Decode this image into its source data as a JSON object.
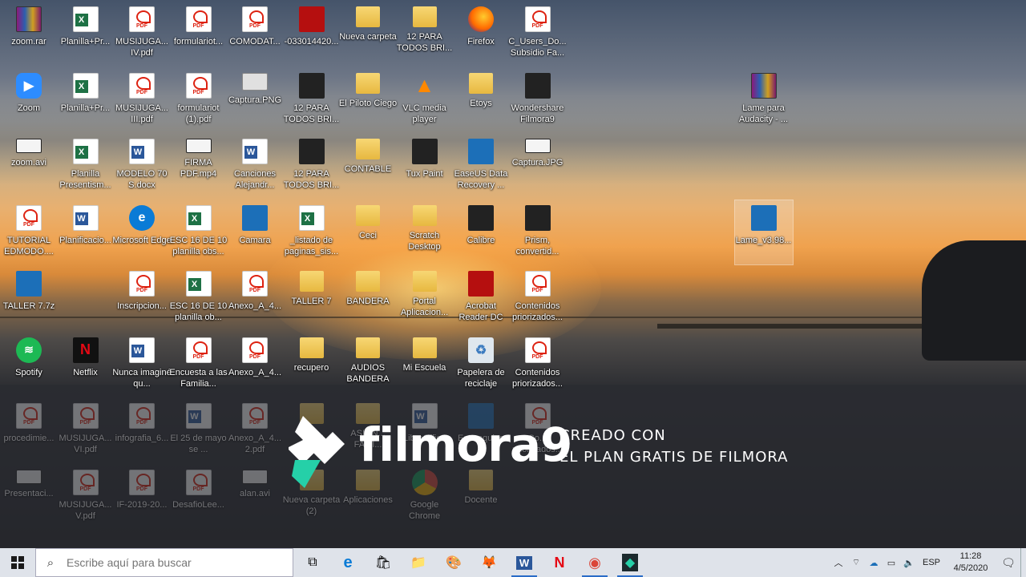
{
  "desktop": {
    "icons": [
      {
        "label": "zoom.rar",
        "type": "rar",
        "col": 0,
        "row": 0
      },
      {
        "label": "Planilla+Pr...",
        "type": "xls",
        "col": 1,
        "row": 0
      },
      {
        "label": "MUSIJUGA... IV.pdf",
        "type": "pdf",
        "col": 2,
        "row": 0
      },
      {
        "label": "formulariot...",
        "type": "pdf",
        "col": 3,
        "row": 0
      },
      {
        "label": "COMODAT...",
        "type": "pdf",
        "col": 4,
        "row": 0
      },
      {
        "label": "-033014420...",
        "type": "red",
        "col": 5,
        "row": 0
      },
      {
        "label": "Nueva carpeta",
        "type": "folder",
        "col": 6,
        "row": 0
      },
      {
        "label": "12 PARA TODOS BRI...",
        "type": "folder",
        "col": 7,
        "row": 0
      },
      {
        "label": "Firefox",
        "type": "firefox",
        "col": 8,
        "row": 0
      },
      {
        "label": "C_Users_Do... Subsidio Fa...",
        "type": "pdf",
        "col": 9,
        "row": 0
      },
      {
        "label": "Zoom",
        "type": "zoom",
        "col": 0,
        "row": 1
      },
      {
        "label": "Planilla+Pr...",
        "type": "xls",
        "col": 1,
        "row": 1
      },
      {
        "label": "MUSIJUGA... III.pdf",
        "type": "pdf",
        "col": 2,
        "row": 1
      },
      {
        "label": "formulariot (1).pdf",
        "type": "pdf",
        "col": 3,
        "row": 1
      },
      {
        "label": "Captura.PNG",
        "type": "img",
        "col": 4,
        "row": 1
      },
      {
        "label": "12 PARA TODOS BRI...",
        "type": "black",
        "col": 5,
        "row": 1
      },
      {
        "label": "El Piloto Ciego",
        "type": "folder",
        "col": 6,
        "row": 1
      },
      {
        "label": "VLC media player",
        "type": "vlc",
        "col": 7,
        "row": 1
      },
      {
        "label": "Etoys",
        "type": "folder",
        "col": 8,
        "row": 1
      },
      {
        "label": "Wondershare Filmora9",
        "type": "black",
        "col": 9,
        "row": 1
      },
      {
        "label": "Lame para Audacity - ...",
        "type": "rar",
        "col": 13,
        "row": 1
      },
      {
        "label": "zoom.avi",
        "type": "video",
        "col": 0,
        "row": 2
      },
      {
        "label": "Planilla Presentism...",
        "type": "xls",
        "col": 1,
        "row": 2
      },
      {
        "label": "MODELO 70 S.docx",
        "type": "doc",
        "col": 2,
        "row": 2
      },
      {
        "label": "FIRMA PDF.mp4",
        "type": "video",
        "col": 3,
        "row": 2
      },
      {
        "label": "Canciones Alejandr...",
        "type": "doc",
        "col": 4,
        "row": 2
      },
      {
        "label": "12 PARA TODOS BRI...",
        "type": "black",
        "col": 5,
        "row": 2
      },
      {
        "label": "CONTABLE",
        "type": "folder",
        "col": 6,
        "row": 2
      },
      {
        "label": "Tux Paint",
        "type": "black",
        "col": 7,
        "row": 2
      },
      {
        "label": "EaseUS Data Recovery ...",
        "type": "blue",
        "col": 8,
        "row": 2
      },
      {
        "label": "Captura.JPG",
        "type": "video",
        "col": 9,
        "row": 2
      },
      {
        "label": "TUTORIAL EDMODO....",
        "type": "pdf",
        "col": 0,
        "row": 3
      },
      {
        "label": "Planificacio...",
        "type": "doc",
        "col": 1,
        "row": 3
      },
      {
        "label": "Microsoft Edge",
        "type": "edge",
        "col": 2,
        "row": 3
      },
      {
        "label": "ESC 16 DE 10 planilla obs...",
        "type": "xls",
        "col": 3,
        "row": 3
      },
      {
        "label": "Camara",
        "type": "blue",
        "col": 4,
        "row": 3
      },
      {
        "label": "_listado de paginas_sis...",
        "type": "xls",
        "col": 5,
        "row": 3
      },
      {
        "label": "Ceci",
        "type": "folder",
        "col": 6,
        "row": 3
      },
      {
        "label": "Scratch Desktop",
        "type": "folder",
        "col": 7,
        "row": 3
      },
      {
        "label": "Calibre",
        "type": "black",
        "col": 8,
        "row": 3
      },
      {
        "label": "Prism, convertid...",
        "type": "black",
        "col": 9,
        "row": 3
      },
      {
        "label": "Lame_v3.98...",
        "type": "blue",
        "col": 13,
        "row": 3,
        "selected": true
      },
      {
        "label": "TALLER 7.7z",
        "type": "blue",
        "col": 0,
        "row": 4
      },
      {
        "label": "Inscripcion...",
        "type": "pdf",
        "col": 2,
        "row": 4
      },
      {
        "label": "ESC 16 DE 10 planilla ob...",
        "type": "xls",
        "col": 3,
        "row": 4
      },
      {
        "label": "Anexo_A_4...",
        "type": "pdf",
        "col": 4,
        "row": 4
      },
      {
        "label": "TALLER 7",
        "type": "folder",
        "col": 5,
        "row": 4
      },
      {
        "label": "BANDERA",
        "type": "folder",
        "col": 6,
        "row": 4
      },
      {
        "label": "Portal Aplicacion...",
        "type": "folder",
        "col": 7,
        "row": 4
      },
      {
        "label": "Acrobat Reader DC",
        "type": "red",
        "col": 8,
        "row": 4
      },
      {
        "label": "Contenidos priorizados...",
        "type": "pdf",
        "col": 9,
        "row": 4
      },
      {
        "label": "Spotify",
        "type": "green",
        "col": 0,
        "row": 5
      },
      {
        "label": "Netflix",
        "type": "netflix",
        "col": 1,
        "row": 5
      },
      {
        "label": "Nunca imaginé qu...",
        "type": "doc",
        "col": 2,
        "row": 5
      },
      {
        "label": "Encuesta a las Familia...",
        "type": "pdf",
        "col": 3,
        "row": 5
      },
      {
        "label": "Anexo_A_4...",
        "type": "pdf",
        "col": 4,
        "row": 5
      },
      {
        "label": "recupero",
        "type": "folder",
        "col": 5,
        "row": 5
      },
      {
        "label": "AUDIOS BANDERA",
        "type": "folder",
        "col": 6,
        "row": 5
      },
      {
        "label": "Mi Escuela",
        "type": "folder",
        "col": 7,
        "row": 5
      },
      {
        "label": "Papelera de reciclaje",
        "type": "recycle",
        "col": 8,
        "row": 5
      },
      {
        "label": "Contenidos priorizados...",
        "type": "pdf",
        "col": 9,
        "row": 5
      },
      {
        "label": "procedimie...",
        "type": "pdf",
        "col": 0,
        "row": 6,
        "faded": true
      },
      {
        "label": "MUSIJUGA... VI.pdf",
        "type": "pdf",
        "col": 1,
        "row": 6,
        "faded": true
      },
      {
        "label": "infografia_6...",
        "type": "pdf",
        "col": 2,
        "row": 6,
        "faded": true
      },
      {
        "label": "El 25 de mayo se ...",
        "type": "doc",
        "col": 3,
        "row": 6,
        "faded": true
      },
      {
        "label": "Anexo_A_4... 2.pdf",
        "type": "pdf",
        "col": 4,
        "row": 6,
        "faded": true
      },
      {
        "label": "carp...",
        "type": "folder",
        "col": 5,
        "row": 6,
        "faded": true
      },
      {
        "label": "ASIGN... FAMI...",
        "type": "folder",
        "col": 6,
        "row": 6,
        "faded": true
      },
      {
        "label": "LibreOffice",
        "type": "doc",
        "col": 7,
        "row": 6,
        "faded": true
      },
      {
        "label": "Este equipo",
        "type": "blue",
        "col": 8,
        "row": 6,
        "faded": true
      },
      {
        "label": "Co... priorizados...",
        "type": "pdf",
        "col": 9,
        "row": 6,
        "faded": true
      },
      {
        "label": "Presentaci...",
        "type": "video",
        "col": 0,
        "row": 7,
        "faded": true
      },
      {
        "label": "MUSIJUGA... V.pdf",
        "type": "pdf",
        "col": 1,
        "row": 7,
        "faded": true
      },
      {
        "label": "IF-2019-20...",
        "type": "pdf",
        "col": 2,
        "row": 7,
        "faded": true
      },
      {
        "label": "DesafioLee...",
        "type": "pdf",
        "col": 3,
        "row": 7,
        "faded": true
      },
      {
        "label": "alan.avi",
        "type": "video",
        "col": 4,
        "row": 7,
        "faded": true
      },
      {
        "label": "Nueva carpeta (2)",
        "type": "folder",
        "col": 5,
        "row": 7,
        "faded": true
      },
      {
        "label": "Aplicaciones",
        "type": "folder",
        "col": 6,
        "row": 7,
        "faded": true
      },
      {
        "label": "Google Chrome",
        "type": "chrome",
        "col": 7,
        "row": 7,
        "faded": true
      },
      {
        "label": "Docente",
        "type": "folder",
        "col": 8,
        "row": 7,
        "faded": true
      }
    ]
  },
  "watermark": {
    "brand": "filmora9",
    "line1": "CREADO CON",
    "line2": "EL PLAN GRATIS DE FILMORA"
  },
  "taskbar": {
    "search_placeholder": "Escribe aquí para buscar",
    "apps": [
      {
        "name": "task-view",
        "glyph": "⧉",
        "active": false
      },
      {
        "name": "edge",
        "glyph": "e",
        "active": false
      },
      {
        "name": "store",
        "glyph": "🛍",
        "active": false
      },
      {
        "name": "file-explorer",
        "glyph": "📁",
        "active": false
      },
      {
        "name": "paint",
        "glyph": "🎨",
        "active": false
      },
      {
        "name": "firefox",
        "glyph": "🦊",
        "active": false
      },
      {
        "name": "word",
        "glyph": "W",
        "active": true
      },
      {
        "name": "netflix",
        "glyph": "N",
        "active": false
      },
      {
        "name": "chrome",
        "glyph": "◉",
        "active": true
      },
      {
        "name": "filmora",
        "glyph": "◆",
        "active": true
      }
    ],
    "language": "ESP",
    "time": "11:28",
    "date": "4/5/2020"
  }
}
